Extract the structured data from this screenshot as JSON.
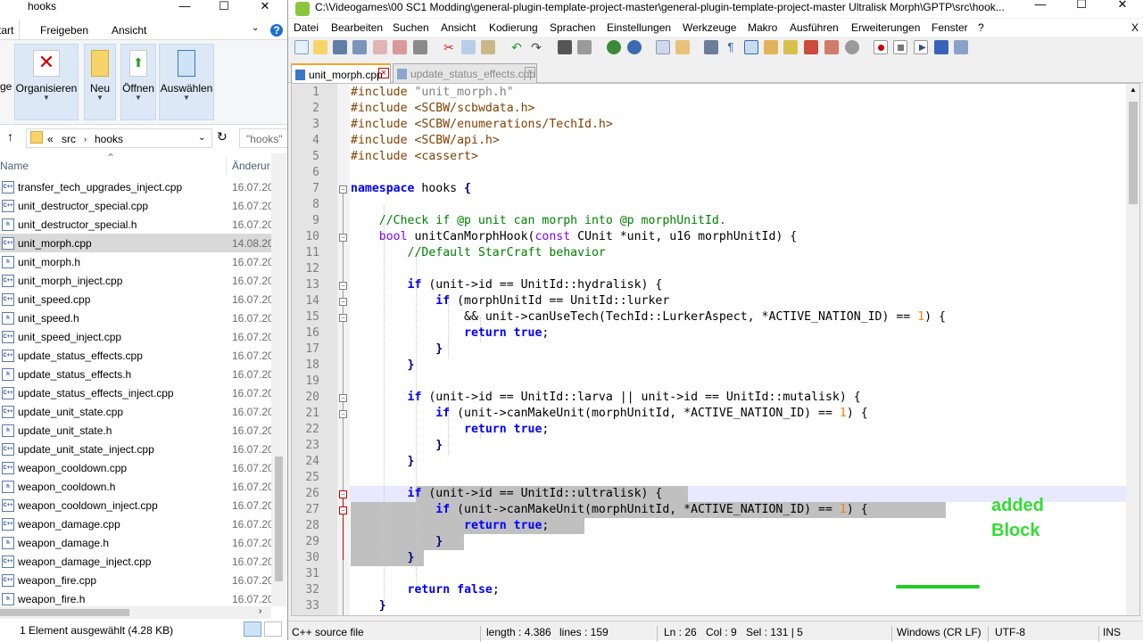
{
  "explorer": {
    "title": "hooks",
    "ribbon_tabs": [
      "Start",
      "Freigeben",
      "Ansicht"
    ],
    "ribbon_buttons": [
      {
        "label": "Organisieren",
        "icon": "delete-icon"
      },
      {
        "label": "Neu",
        "icon": "new-folder-icon"
      },
      {
        "label": "Öffnen",
        "icon": "open-icon"
      },
      {
        "label": "Auswählen",
        "icon": "select-icon"
      }
    ],
    "ribbon_cut_label": "ge",
    "address": {
      "sep": "«",
      "part1": "src",
      "part2": "hooks"
    },
    "search_placeholder": "\"hooks\"",
    "columns": {
      "name": "Name",
      "date": "Änderur"
    },
    "files": [
      {
        "name": "transfer_tech_upgrades_inject.cpp",
        "date": "16.07.20",
        "type": "cpp"
      },
      {
        "name": "unit_destructor_special.cpp",
        "date": "16.07.20",
        "type": "cpp"
      },
      {
        "name": "unit_destructor_special.h",
        "date": "16.07.20",
        "type": "h"
      },
      {
        "name": "unit_morph.cpp",
        "date": "14.08.20",
        "type": "cpp",
        "selected": true
      },
      {
        "name": "unit_morph.h",
        "date": "16.07.20",
        "type": "h"
      },
      {
        "name": "unit_morph_inject.cpp",
        "date": "16.07.20",
        "type": "cpp"
      },
      {
        "name": "unit_speed.cpp",
        "date": "16.07.20",
        "type": "cpp"
      },
      {
        "name": "unit_speed.h",
        "date": "16.07.20",
        "type": "h"
      },
      {
        "name": "unit_speed_inject.cpp",
        "date": "16.07.20",
        "type": "cpp"
      },
      {
        "name": "update_status_effects.cpp",
        "date": "16.07.20",
        "type": "cpp"
      },
      {
        "name": "update_status_effects.h",
        "date": "16.07.20",
        "type": "h"
      },
      {
        "name": "update_status_effects_inject.cpp",
        "date": "16.07.20",
        "type": "cpp"
      },
      {
        "name": "update_unit_state.cpp",
        "date": "16.07.20",
        "type": "cpp"
      },
      {
        "name": "update_unit_state.h",
        "date": "16.07.20",
        "type": "h"
      },
      {
        "name": "update_unit_state_inject.cpp",
        "date": "16.07.20",
        "type": "cpp"
      },
      {
        "name": "weapon_cooldown.cpp",
        "date": "16.07.20",
        "type": "cpp"
      },
      {
        "name": "weapon_cooldown.h",
        "date": "16.07.20",
        "type": "h"
      },
      {
        "name": "weapon_cooldown_inject.cpp",
        "date": "16.07.20",
        "type": "cpp"
      },
      {
        "name": "weapon_damage.cpp",
        "date": "16.07.20",
        "type": "cpp"
      },
      {
        "name": "weapon_damage.h",
        "date": "16.07.20",
        "type": "h"
      },
      {
        "name": "weapon_damage_inject.cpp",
        "date": "16.07.20",
        "type": "cpp"
      },
      {
        "name": "weapon_fire.cpp",
        "date": "16.07.20",
        "type": "cpp"
      },
      {
        "name": "weapon_fire.h",
        "date": "16.07.20",
        "type": "h"
      }
    ],
    "status": "1 Element ausgewählt (4.28 KB)"
  },
  "npp": {
    "title": "C:\\Videogames\\00 SC1 Modding\\general-plugin-template-project-master\\general-plugin-template-project-master Ultralisk Morph\\GPTP\\src\\hook...",
    "menu": [
      "Datei",
      "Bearbeiten",
      "Suchen",
      "Ansicht",
      "Kodierung",
      "Sprachen",
      "Einstellungen",
      "Werkzeuge",
      "Makro",
      "Ausführen",
      "Erweiterungen",
      "Fenster",
      "?"
    ],
    "menu_close": "X",
    "tabs": [
      {
        "label": "unit_morph.cpp",
        "active": true
      },
      {
        "label": "update_status_effects.cpp",
        "active": false
      }
    ],
    "line_numbers": [
      "1",
      "2",
      "3",
      "4",
      "5",
      "6",
      "7",
      "8",
      "9",
      "10",
      "11",
      "12",
      "13",
      "14",
      "15",
      "16",
      "17",
      "18",
      "19",
      "20",
      "21",
      "22",
      "23",
      "24",
      "25",
      "26",
      "27",
      "28",
      "29",
      "30",
      "31",
      "32",
      "33"
    ],
    "code": {
      "inc1_kw": "#include",
      "inc1_path": "\"unit_morph.h\"",
      "inc2_kw": "#include",
      "inc2_path": "<SCBW/scbwdata.h>",
      "inc3_kw": "#include",
      "inc3_path": "<SCBW/enumerations/TechId.h>",
      "inc4_kw": "#include",
      "inc4_path": "<SCBW/api.h>",
      "inc5_kw": "#include",
      "inc5_path": "<cassert>",
      "ns_kw": "namespace",
      "ns_name": " hooks ",
      "ns_brace": "{",
      "c9": "//Check if @p unit can morph into @p morphUnitId.",
      "l10_bool": "bool",
      "l10_a": " unitCanMorphHook(",
      "l10_const": "const",
      "l10_b": " CUnit *unit, u16 morphUnitId) {",
      "c11": "//Default StarCraft behavior",
      "if_kw": "if",
      "l13": " (unit->id == UnitId::hydralisk) {",
      "l14": " (morphUnitId == UnitId::lurker",
      "l15_a": "&& unit->canUseTech(TechId::LurkerAspect, *ACTIVE_NATION_ID) == ",
      "l15_num": "1",
      "l15_b": ") {",
      "return_kw": "return",
      "true_kw": "true",
      "false_kw": "false",
      "semi": ";",
      "close_brace": "}",
      "l20": " (unit->id == UnitId::larva || unit->id == UnitId::mutalisk) {",
      "l21_a": " (unit->canMakeUnit(morphUnitId, *ACTIVE_NATION_ID) == ",
      "l21_num": "1",
      "l21_b": ") {",
      "l26": " (unit->id == UnitId::ultralisk) {",
      "l27_a": " (unit->canMakeUnit(morphUnitId, *ACTIVE_NATION_ID) == ",
      "l27_num": "1",
      "l27_b": ") {"
    },
    "annotation": "added\nBlock",
    "status": {
      "lang": "C++ source file",
      "length": "length : 4.386",
      "lines": "lines : 159",
      "ln": "Ln : 26",
      "col": "Col : 9",
      "sel": "Sel : 131 | 5",
      "eol": "Windows (CR LF)",
      "enc": "UTF-8",
      "mode": "INS"
    }
  },
  "colors": {
    "selection": "#c0c0c0",
    "caret_line": "#e8e8ff",
    "annotation": "#33dd33"
  }
}
